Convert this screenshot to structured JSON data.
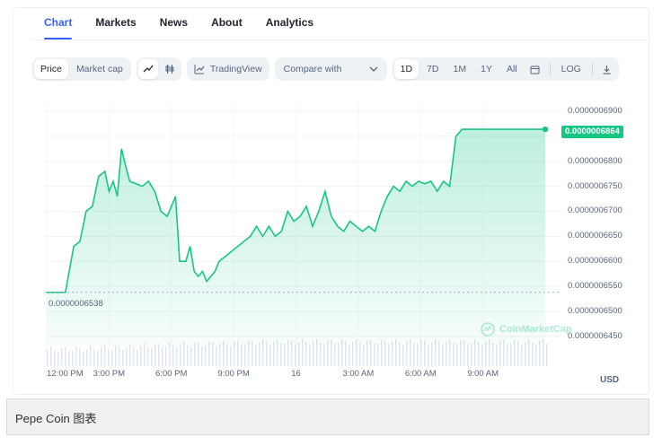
{
  "tabs": [
    "Chart",
    "Markets",
    "News",
    "About",
    "Analytics"
  ],
  "toolbar": {
    "price_label": "Price",
    "marketcap_label": "Market cap",
    "tradingview_label": "TradingView",
    "compare_label": "Compare with",
    "ranges": [
      "1D",
      "7D",
      "1M",
      "1Y",
      "All"
    ],
    "log_label": "LOG"
  },
  "chart_data": {
    "type": "area",
    "y_ticks": [
      "0.0000006900",
      "0.0000006850",
      "0.0000006800",
      "0.0000006750",
      "0.0000006700",
      "0.0000006650",
      "0.0000006600",
      "0.0000006550",
      "0.0000006500",
      "0.0000006450"
    ],
    "x_ticks": [
      "12:00 PM",
      "3:00 PM",
      "6:00 PM",
      "9:00 PM",
      "16",
      "3:00 AM",
      "6:00 AM",
      "9:00 AM"
    ],
    "ylim": [
      6.43e-07,
      6.9e-07
    ],
    "current_price_label": "0.0000006864",
    "open_price_label": "0.0000006538",
    "currency": "USD",
    "line_color": "#16c784",
    "x_hours": [
      0,
      0.5,
      0.9,
      1.3,
      1.6,
      1.9,
      2.2,
      2.5,
      2.8,
      3.0,
      3.2,
      3.4,
      3.6,
      3.8,
      4.0,
      4.3,
      4.6,
      4.9,
      5.2,
      5.5,
      5.8,
      6.0,
      6.2,
      6.4,
      6.7,
      6.9,
      7.1,
      7.3,
      7.5,
      7.7,
      7.9,
      8.1,
      8.3,
      8.6,
      8.9,
      9.2,
      9.5,
      9.8,
      10.1,
      10.4,
      10.7,
      11.0,
      11.3,
      11.6,
      11.9,
      12.2,
      12.5,
      12.8,
      13.1,
      13.4,
      13.7,
      14.0,
      14.3,
      14.6,
      14.9,
      15.2,
      15.5,
      15.8,
      16.1,
      16.4,
      16.7,
      17.0,
      17.3,
      17.6,
      17.9,
      18.2,
      18.5,
      18.8,
      19.1,
      19.4,
      19.7,
      20.0,
      20.3,
      20.6,
      20.9,
      21.2,
      21.5,
      21.8,
      22.1,
      22.4,
      22.7,
      23.0,
      23.3,
      23.5,
      23.7,
      23.9,
      24.0
    ],
    "y_values": [
      6.538e-07,
      6.538e-07,
      6.538e-07,
      6.63e-07,
      6.64e-07,
      6.7e-07,
      6.71e-07,
      6.77e-07,
      6.78e-07,
      6.74e-07,
      6.76e-07,
      6.73e-07,
      6.825e-07,
      6.79e-07,
      6.76e-07,
      6.755e-07,
      6.75e-07,
      6.76e-07,
      6.74e-07,
      6.7e-07,
      6.69e-07,
      6.71e-07,
      6.73e-07,
      6.6e-07,
      6.6e-07,
      6.63e-07,
      6.58e-07,
      6.57e-07,
      6.58e-07,
      6.56e-07,
      6.57e-07,
      6.58e-07,
      6.6e-07,
      6.61e-07,
      6.62e-07,
      6.63e-07,
      6.64e-07,
      6.65e-07,
      6.67e-07,
      6.65e-07,
      6.67e-07,
      6.65e-07,
      6.66e-07,
      6.7e-07,
      6.68e-07,
      6.69e-07,
      6.71e-07,
      6.67e-07,
      6.7e-07,
      6.74e-07,
      6.69e-07,
      6.67e-07,
      6.66e-07,
      6.68e-07,
      6.67e-07,
      6.66e-07,
      6.67e-07,
      6.66e-07,
      6.7e-07,
      6.73e-07,
      6.75e-07,
      6.74e-07,
      6.76e-07,
      6.75e-07,
      6.76e-07,
      6.755e-07,
      6.76e-07,
      6.74e-07,
      6.76e-07,
      6.75e-07,
      6.85e-07,
      6.864e-07,
      6.864e-07,
      6.864e-07,
      6.864e-07,
      6.864e-07,
      6.864e-07,
      6.864e-07,
      6.864e-07,
      6.864e-07,
      6.864e-07,
      6.864e-07,
      6.864e-07,
      6.864e-07,
      6.864e-07,
      6.864e-07,
      6.864e-07
    ]
  },
  "watermark": "CoinMarketCap",
  "caption": "Pepe Coin 图表"
}
